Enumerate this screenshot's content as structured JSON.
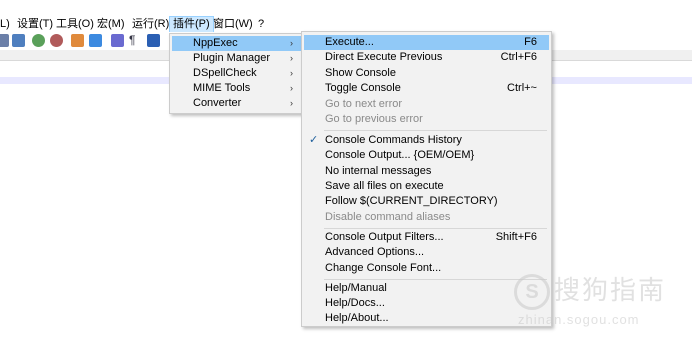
{
  "menubar": {
    "items": [
      {
        "label": "L)"
      },
      {
        "label": "设置(T)"
      },
      {
        "label": "工具(O)"
      },
      {
        "label": "宏(M)"
      },
      {
        "label": "运行(R)"
      },
      {
        "label": "插件(P)"
      },
      {
        "label": "窗口(W)"
      },
      {
        "label": "?"
      }
    ]
  },
  "plugins_menu": {
    "items": [
      {
        "label": "NppExec"
      },
      {
        "label": "Plugin Manager"
      },
      {
        "label": "DSpellCheck"
      },
      {
        "label": "MIME Tools"
      },
      {
        "label": "Converter"
      }
    ],
    "arrow": "›"
  },
  "nppexec_menu": {
    "group1": [
      {
        "label": "Execute...",
        "shortcut": "F6"
      },
      {
        "label": "Direct Execute Previous",
        "shortcut": "Ctrl+F6"
      },
      {
        "label": "Show Console",
        "shortcut": ""
      },
      {
        "label": "Toggle Console",
        "shortcut": "Ctrl+~"
      },
      {
        "label": "Go to next error",
        "shortcut": ""
      },
      {
        "label": "Go to previous error",
        "shortcut": ""
      }
    ],
    "group2": [
      {
        "label": "Console Commands History"
      },
      {
        "label": "Console Output... {OEM/OEM}"
      },
      {
        "label": "No internal messages"
      },
      {
        "label": "Save all files on execute"
      },
      {
        "label": "Follow $(CURRENT_DIRECTORY)"
      },
      {
        "label": "Disable command aliases"
      }
    ],
    "group3": [
      {
        "label": "Console Output Filters...",
        "shortcut": "Shift+F6"
      },
      {
        "label": "Advanced Options...",
        "shortcut": ""
      },
      {
        "label": "Change Console Font...",
        "shortcut": ""
      }
    ],
    "group4": [
      {
        "label": "Help/Manual"
      },
      {
        "label": "Help/Docs..."
      },
      {
        "label": "Help/About..."
      }
    ],
    "check_glyph": "✓"
  },
  "watermark": {
    "logo": "S",
    "text": "搜狗指南",
    "url": "zhinan.sogou.com"
  },
  "colors": {
    "highlight": "#91c9f7",
    "menu_bg": "#f2f2f2",
    "menubar_active": "#cce8ff"
  }
}
